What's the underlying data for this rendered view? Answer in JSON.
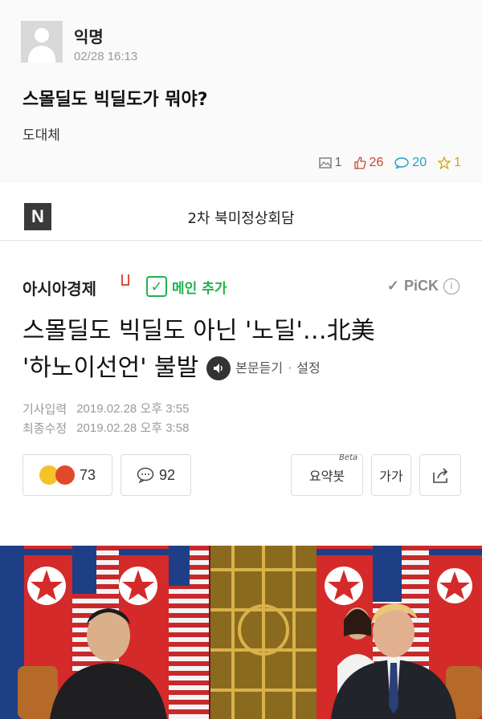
{
  "post": {
    "author": "익명",
    "time": "02/28 16:13",
    "title": "스몰딜도 빅딜도가 뭐야?",
    "body": "도대체",
    "stats": {
      "images": "1",
      "likes": "26",
      "comments": "20",
      "scraps": "1"
    }
  },
  "nav": {
    "logo": "N",
    "title": "2차 북미정상회담"
  },
  "article": {
    "publisher": "아시아경제",
    "add_main_label": "메인 추가",
    "pick_label": "PiCK",
    "headline_line1": "스몰딜도 빅딜도 아닌 '노딜'…北美",
    "headline_line2": "'하노이선언' 불발",
    "listen_label": "본문듣기",
    "settings_label": "설정",
    "dates": {
      "input_label": "기사입력",
      "input_value": "2019.02.28 오후 3:55",
      "modified_label": "최종수정",
      "modified_value": "2019.02.28 오후 3:58"
    },
    "actions": {
      "reactions": "73",
      "comments": "92",
      "summary_label": "요약봇",
      "summary_badge": "Beta",
      "font_label": "가가"
    }
  },
  "colors": {
    "like": "#c9452a",
    "comment": "#1fa0c8",
    "scrap": "#d7a700",
    "add_main": "#22b14c",
    "flag_red": "#d42a2a",
    "flag_blue": "#1e3f86"
  },
  "icons": [
    "image-icon",
    "thumb-up-icon",
    "comment-bubble-icon",
    "star-icon",
    "check-icon",
    "info-icon",
    "speaker-icon",
    "share-icon"
  ]
}
